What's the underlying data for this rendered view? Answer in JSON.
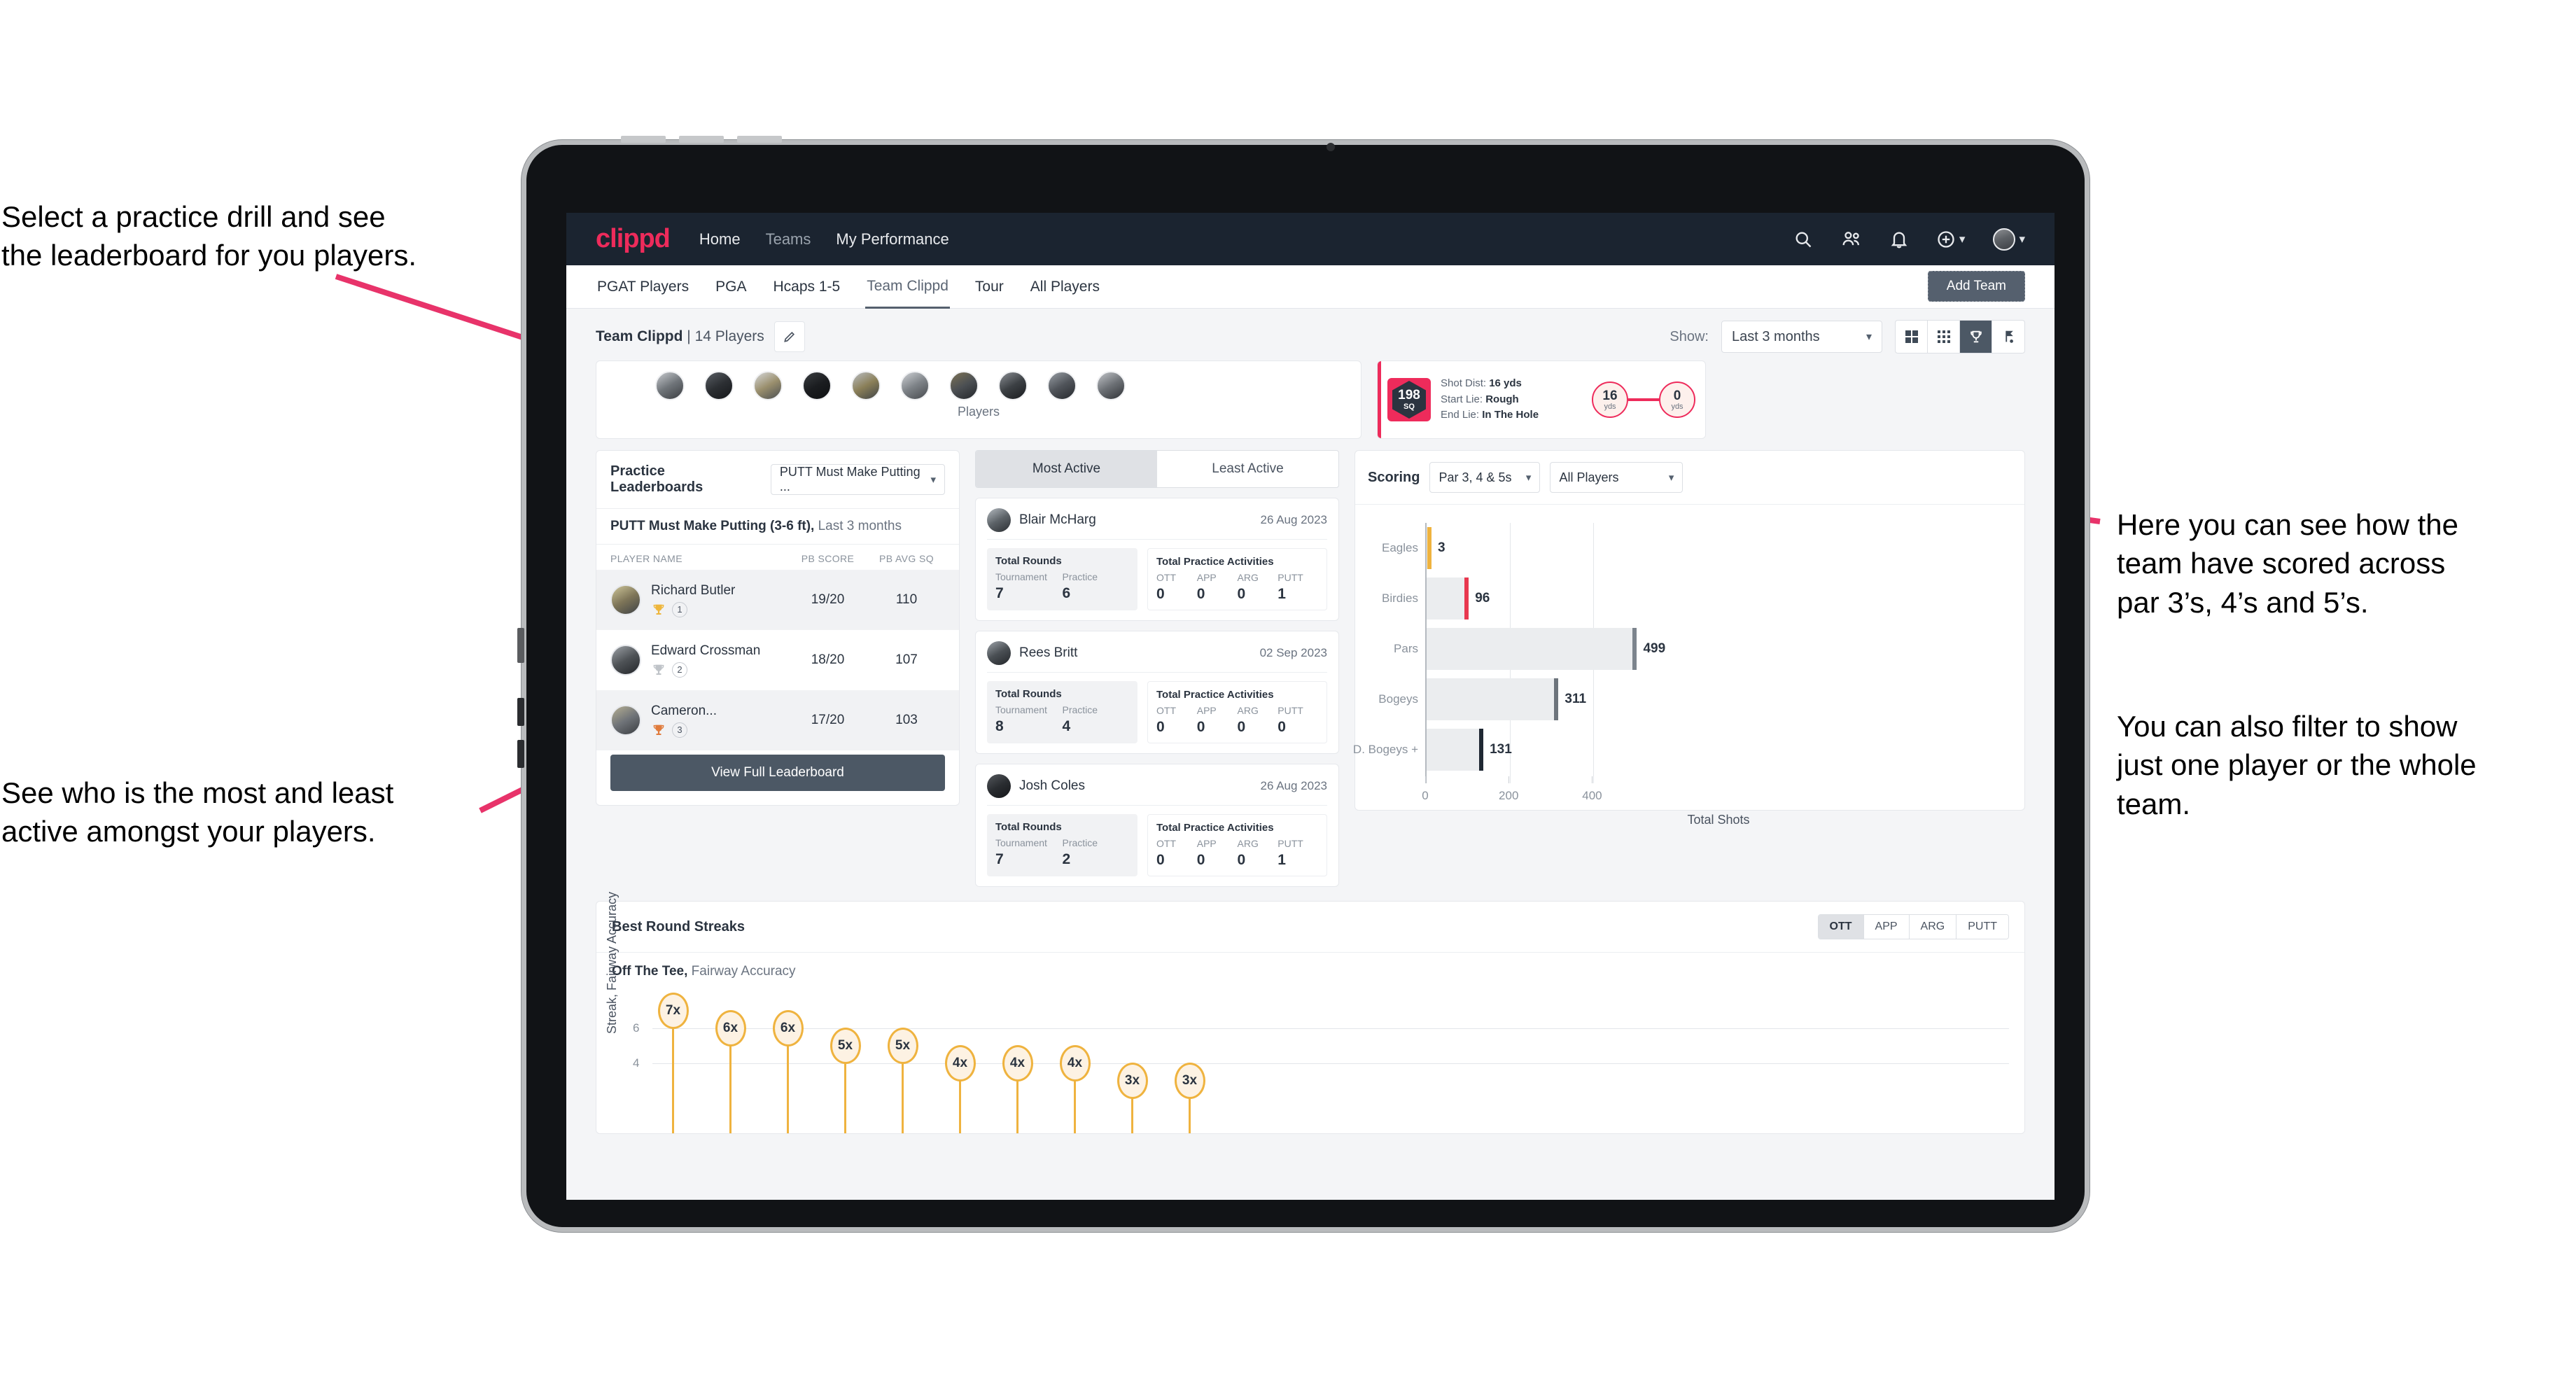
{
  "annotations": {
    "top_left": "Select a practice drill and see\nthe leaderboard for you players.",
    "bottom_left": "See who is the most and least\nactive amongst your players.",
    "right_1": "Here you can see how the\nteam have scored across\npar 3’s, 4’s and 5’s.",
    "right_2": "You can also filter to show\njust one player or the whole\nteam."
  },
  "topnav": {
    "brand": "clippd",
    "links": [
      {
        "label": "Home",
        "active": true
      },
      {
        "label": "Teams",
        "active": false
      },
      {
        "label": "My Performance",
        "active": true
      }
    ],
    "icons": [
      "search-icon",
      "people-icon",
      "bell-icon",
      "plus-circle-icon",
      "avatar"
    ]
  },
  "tabs": [
    {
      "label": "PGAT Players",
      "active": false
    },
    {
      "label": "PGA",
      "active": false
    },
    {
      "label": "Hcaps 1-5",
      "active": false
    },
    {
      "label": "Team Clippd",
      "active": true
    },
    {
      "label": "Tour",
      "active": false
    },
    {
      "label": "All Players",
      "active": false
    }
  ],
  "add_team_button": "Add Team",
  "toolbar": {
    "team_name": "Team Clippd",
    "separator": " | ",
    "player_count": "14 Players",
    "edit_icon": "pencil-icon",
    "show_label": "Show:",
    "show_value": "Last 3 months",
    "view_toggles": [
      {
        "name": "grid-large-icon",
        "selected": false
      },
      {
        "name": "grid-small-icon",
        "selected": false
      },
      {
        "name": "trophy-icon",
        "selected": true
      },
      {
        "name": "flag-icon",
        "selected": false
      }
    ]
  },
  "players_strip": {
    "label": "Players",
    "count": 10
  },
  "shot_card": {
    "sq_value": "198",
    "sq_unit": "SQ",
    "shot_dist_label": "Shot Dist:",
    "shot_dist_value": "16 yds",
    "start_lie_label": "Start Lie:",
    "start_lie_value": "Rough",
    "end_lie_label": "End Lie:",
    "end_lie_value": "In The Hole",
    "from_value": "16",
    "from_unit": "yds",
    "to_value": "0",
    "to_unit": "yds"
  },
  "practice_leaderboard": {
    "title": "Practice Leaderboards",
    "drill_select": "PUTT Must Make Putting ...",
    "subtitle_bold": "PUTT Must Make Putting (3-6 ft),",
    "subtitle_light": "Last 3 months",
    "columns": [
      "PLAYER NAME",
      "PB SCORE",
      "PB AVG SQ"
    ],
    "rows": [
      {
        "name": "Richard Butler",
        "rank": "1",
        "trophy": "gold",
        "pb_score": "19/20",
        "pb_avg_sq": "110"
      },
      {
        "name": "Edward Crossman",
        "rank": "2",
        "trophy": "silver",
        "pb_score": "18/20",
        "pb_avg_sq": "107"
      },
      {
        "name": "Cameron...",
        "rank": "3",
        "trophy": "bronze",
        "pb_score": "17/20",
        "pb_avg_sq": "103"
      }
    ],
    "view_full_button": "View Full Leaderboard"
  },
  "activity": {
    "tabs": [
      {
        "label": "Most Active",
        "selected": true
      },
      {
        "label": "Least Active",
        "selected": false
      }
    ],
    "rounds_title": "Total Rounds",
    "rounds_keys": [
      "Tournament",
      "Practice"
    ],
    "acts_title": "Total Practice Activities",
    "acts_keys": [
      "OTT",
      "APP",
      "ARG",
      "PUTT"
    ],
    "players": [
      {
        "name": "Blair McHarg",
        "date": "26 Aug 2023",
        "tournament": "7",
        "practice": "6",
        "ott": "0",
        "app": "0",
        "arg": "0",
        "putt": "1"
      },
      {
        "name": "Rees Britt",
        "date": "02 Sep 2023",
        "tournament": "8",
        "practice": "4",
        "ott": "0",
        "app": "0",
        "arg": "0",
        "putt": "0"
      },
      {
        "name": "Josh Coles",
        "date": "26 Aug 2023",
        "tournament": "7",
        "practice": "2",
        "ott": "0",
        "app": "0",
        "arg": "0",
        "putt": "1"
      }
    ]
  },
  "scoring": {
    "title": "Scoring",
    "par_select": "Par 3, 4 & 5s",
    "player_select": "All Players"
  },
  "best_round_streaks": {
    "title": "Best Round Streaks",
    "toggle": [
      {
        "label": "OTT",
        "selected": true
      },
      {
        "label": "APP",
        "selected": false
      },
      {
        "label": "ARG",
        "selected": false
      },
      {
        "label": "PUTT",
        "selected": false
      }
    ],
    "subtitle_bold": "Off The Tee,",
    "subtitle_light": "Fairway Accuracy"
  },
  "chart_data": [
    {
      "type": "bar",
      "orientation": "horizontal",
      "title": "Scoring",
      "categories": [
        "Eagles",
        "Birdies",
        "Pars",
        "Bogeys",
        "D. Bogeys +"
      ],
      "values": [
        3,
        96,
        499,
        311,
        131
      ],
      "cap_colors": [
        "#efb33f",
        "#e8384f",
        "#7c848d",
        "#6d747c",
        "#1f2833"
      ],
      "xlabel": "Total Shots",
      "ylabel": "",
      "xlim": [
        0,
        520
      ],
      "xticks": [
        0,
        200,
        400
      ],
      "grid": true,
      "legend": "none"
    },
    {
      "type": "lollipop",
      "title": "Best Round Streaks",
      "subtitle": "Off The Tee, Fairway Accuracy",
      "ylabel": "Streak, Fairway Accuracy",
      "yticks": [
        4,
        6
      ],
      "ylim": [
        0,
        8
      ],
      "labels": [
        "7x",
        "6x",
        "6x",
        "5x",
        "5x",
        "4x",
        "4x",
        "4x",
        "3x",
        "3x"
      ],
      "values": [
        7,
        6,
        6,
        5,
        5,
        4,
        4,
        4,
        3,
        3
      ],
      "marker_color": "#efb33f",
      "grid": true,
      "legend": "none"
    }
  ]
}
